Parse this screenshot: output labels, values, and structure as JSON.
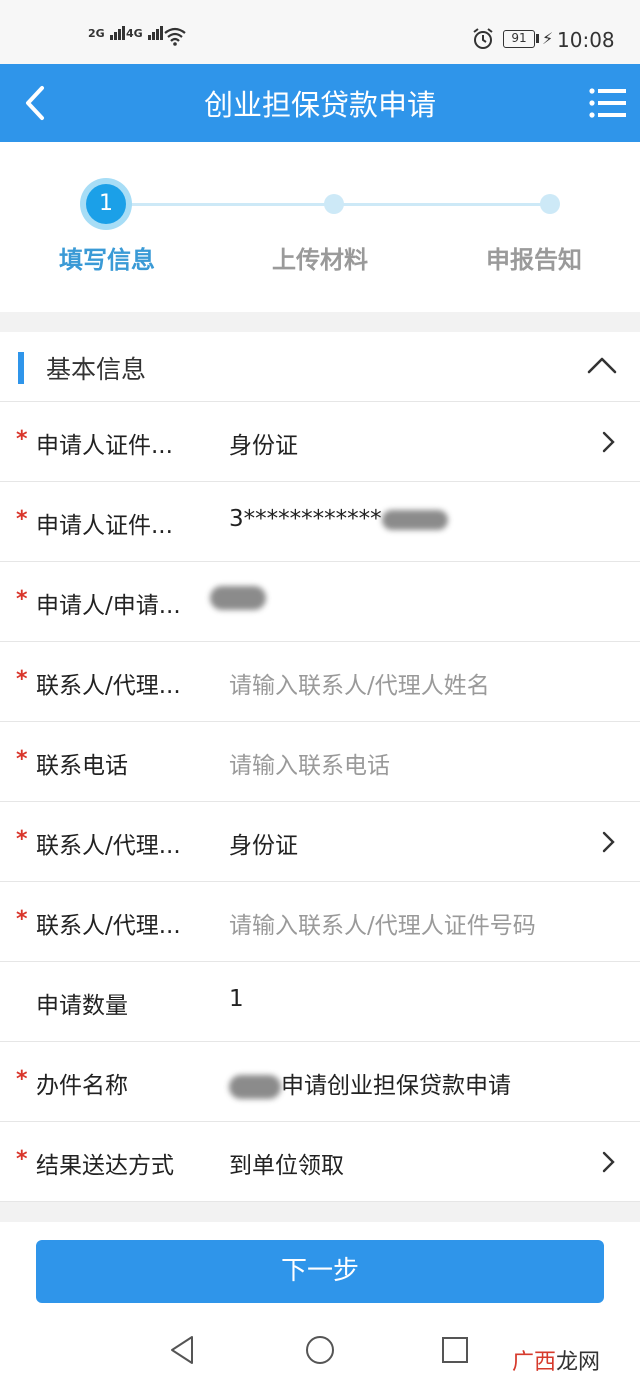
{
  "status_bar": {
    "signal1": "2G",
    "signal2": "4G",
    "battery": "91",
    "time": "10:08"
  },
  "header": {
    "title": "创业担保贷款申请"
  },
  "steps": [
    {
      "number": "1",
      "label": "填写信息",
      "active": true
    },
    {
      "label": "上传材料",
      "active": false
    },
    {
      "label": "申报告知",
      "active": false
    }
  ],
  "section": {
    "title": "基本信息"
  },
  "rows": [
    {
      "required": "*",
      "label": "申请人证件...",
      "value": "身份证",
      "kind": "select"
    },
    {
      "required": "*",
      "label": "申请人证件...",
      "value": "3************",
      "kind": "text"
    },
    {
      "required": "*",
      "label": "申请人/申请...",
      "value": "",
      "kind": "text"
    },
    {
      "required": "*",
      "label": "联系人/代理...",
      "placeholder": "请输入联系人/代理人姓名",
      "kind": "input"
    },
    {
      "required": "*",
      "label": "联系电话",
      "placeholder": "请输入联系电话",
      "kind": "input"
    },
    {
      "required": "*",
      "label": "联系人/代理...",
      "value": "身份证",
      "kind": "select"
    },
    {
      "required": "*",
      "label": "联系人/代理...",
      "placeholder": "请输入联系人/代理人证件号码",
      "kind": "input"
    },
    {
      "required": "",
      "label": "申请数量",
      "value": "1",
      "kind": "text"
    },
    {
      "required": "*",
      "label": "办件名称",
      "value": "申请创业担保贷款申请",
      "kind": "text"
    },
    {
      "required": "*",
      "label": "结果送达方式",
      "value": "到单位领取",
      "kind": "select"
    }
  ],
  "next_button": "下一步",
  "watermark": {
    "part1": "广西",
    "part2": "龙网"
  },
  "colors": {
    "primary": "#2f95ea",
    "required": "#d9352b"
  }
}
